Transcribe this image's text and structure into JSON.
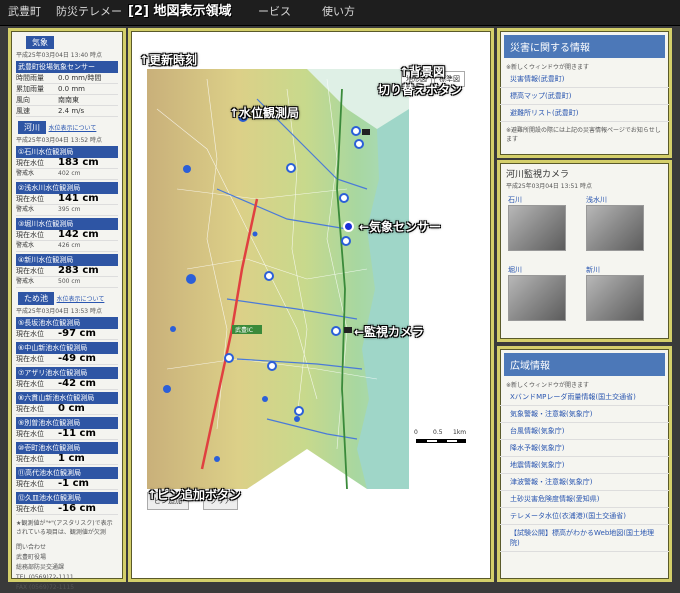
{
  "topbar": {
    "town": "武豊町",
    "service_partial": "防災テレメー",
    "section_label": "[2] 地図表示領域",
    "service_tail": "ービス",
    "howto": "使い方"
  },
  "left": {
    "weather_btn": "気象",
    "weather_time": "平成25年03月04日 13:40 時点",
    "weather_station": "武豊町役場気象センサー",
    "weather_rows": [
      {
        "k": "時間雨量",
        "v": "0.0 mm/時間"
      },
      {
        "k": "累加雨量",
        "v": "0.0 mm"
      },
      {
        "k": "風向",
        "v": "南南東"
      },
      {
        "k": "風速",
        "v": "2.4 m/s"
      }
    ],
    "river_btn": "河川",
    "river_link": "水位表示について",
    "river_time": "平成25年03月04日 13:52 時点",
    "river_stations": [
      {
        "name": "①石川水位観測局",
        "level": "183 cm",
        "alert": "402 cm"
      },
      {
        "name": "②浅水川水位観測局",
        "level": "141 cm",
        "alert": "395 cm"
      },
      {
        "name": "③堀川水位観測局",
        "level": "142 cm",
        "alert": "426 cm"
      },
      {
        "name": "④新川水位観測局",
        "level": "283 cm",
        "alert": "500 cm"
      }
    ],
    "now_label": "現在水位",
    "alert_label": "警戒水",
    "pond_btn": "ため池",
    "pond_link": "水位表示について",
    "pond_time": "平成25年03月04日 13:53 時点",
    "ponds": [
      {
        "name": "⑤長坂池水位観測局",
        "level": "-97 cm"
      },
      {
        "name": "⑥中山新池水位観測局",
        "level": "-49 cm"
      },
      {
        "name": "⑦アザリ池水位観測局",
        "level": "-42 cm"
      },
      {
        "name": "⑧六貫山新池水位観測局",
        "level": "0 cm"
      },
      {
        "name": "⑨別曽池水位観測局",
        "level": "-11 cm"
      },
      {
        "name": "⑩壱町池水位観測局",
        "level": "1 cm"
      },
      {
        "name": "⑪高代池水位観測局",
        "level": "-1 cm"
      },
      {
        "name": "⑫久皿池水位観測局",
        "level": "-16 cm"
      }
    ],
    "footnote": "★観測値が\"*\"(アスタリスク)で表示されている項目は、観測値が欠測",
    "contact_title": "問い合わせ",
    "contact_org": "武豊町役場",
    "contact_dept": "総務部防災交通課",
    "tel": "TEL (0569)72-1111",
    "fax": "FAX (0569)72-1115"
  },
  "center": {
    "btn_terrain": "地形図",
    "btn_standard": "標準図",
    "btn_pin_add": "ピン追加",
    "btn_clear": "クリア",
    "highway_label": "武豊IC",
    "scale": [
      "0",
      "0.5",
      "1km"
    ],
    "annotations": {
      "update_time": "↑更新時刻",
      "bg_switch_1": "↑背景図",
      "bg_switch_2": "切り替えボタン",
      "water_station": "↑水位観測局",
      "weather_sensor": "←気象センサー",
      "camera": "←監視カメラ",
      "pin_add": "↑ピン追加ボタン"
    }
  },
  "right": {
    "disaster_title": "災害に関する情報",
    "disaster_note": "※新しくウィンドウが開きます",
    "disaster_links": [
      "災害情報(武豊町)",
      "標高マップ(武豊町)",
      "避難所リスト(武豊町)"
    ],
    "disaster_footer": "※避難所開設の際には上記の災害情報ページでお知らせします",
    "camera_title": "河川監視カメラ",
    "camera_time": "平成25年03月04日 13:51 時点",
    "cameras": [
      "石川",
      "浅水川",
      "堀川",
      "新川"
    ],
    "wide_title": "広域情報",
    "wide_note": "※新しくウィンドウが開きます",
    "wide_links": [
      "XバンドMPレーダ雨量情報(国土交通省)",
      "気象警報・注意報(気象庁)",
      "台風情報(気象庁)",
      "降水予報(気象庁)",
      "地震情報(気象庁)",
      "津波警報・注意報(気象庁)",
      "土砂災害危険度情報(愛知県)",
      "テレメータ水位(衣浦港)(国土交通省)",
      "【試験公開】標高がわかるWeb地図(国土地理院)"
    ]
  },
  "colors": {
    "frame": "#d4cf6a",
    "section_blue": "#2e55a4",
    "link": "#2a56b0",
    "sea": "#9fd6c8"
  },
  "icons": [
    "weather-sensor-icon",
    "water-station-icon",
    "camera-icon",
    "pin-icon"
  ]
}
